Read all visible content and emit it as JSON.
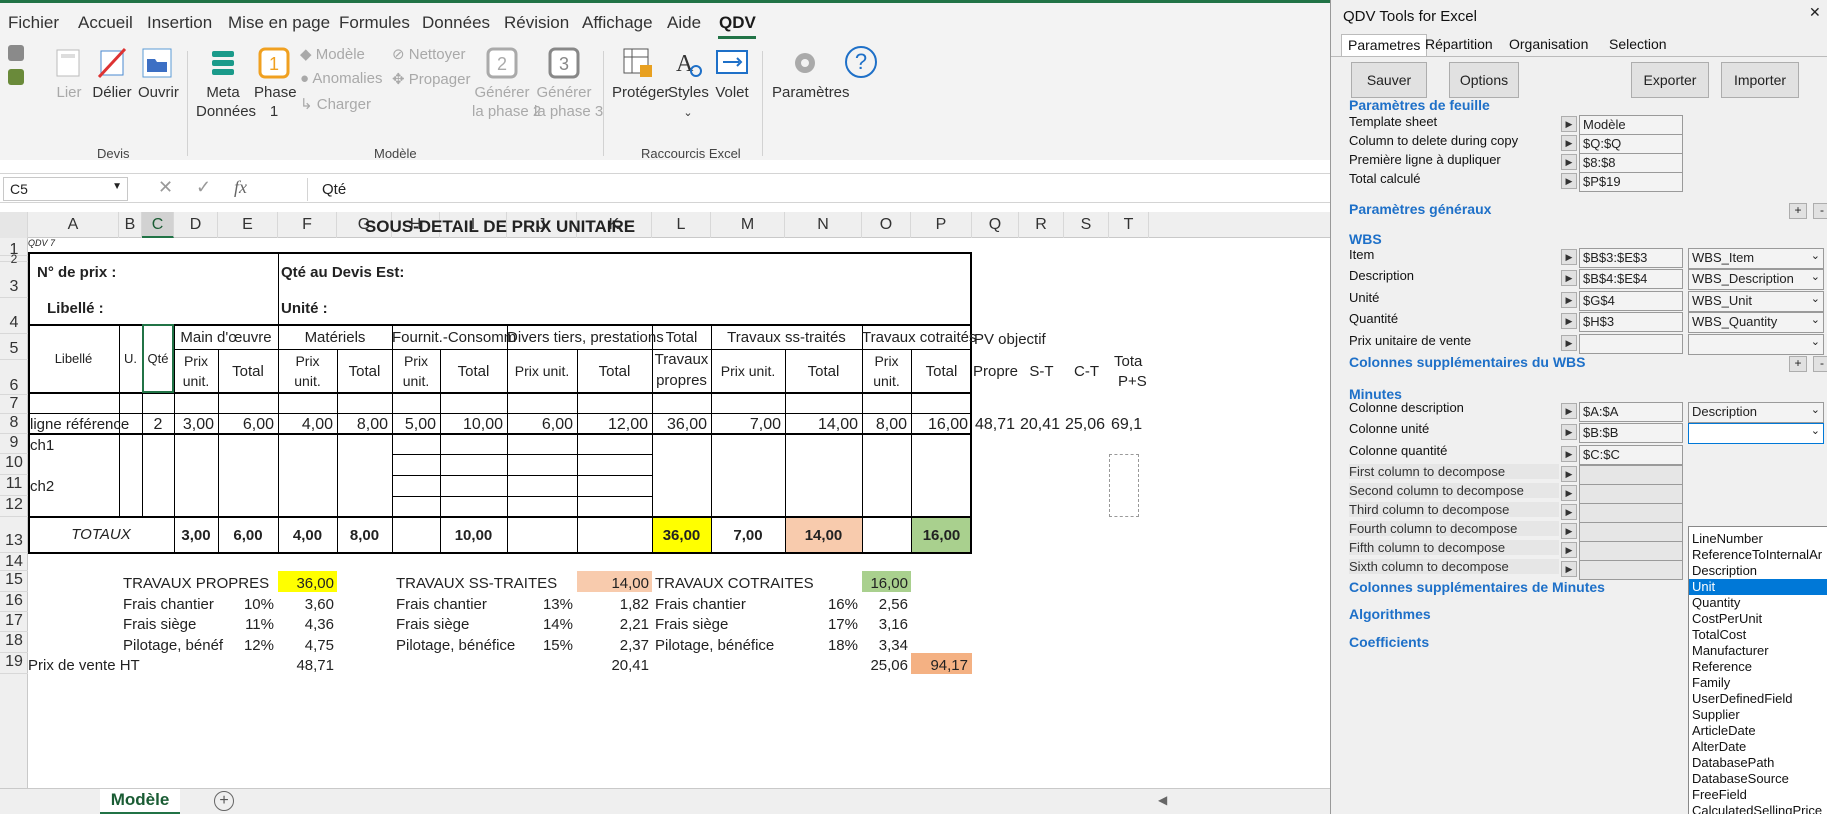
{
  "menu": [
    "Fichier",
    "Accueil",
    "Insertion",
    "Mise en page",
    "Formules",
    "Données",
    "Révision",
    "Affichage",
    "Aide",
    "QDV"
  ],
  "ribbon": {
    "lier": "Lier",
    "delier": "Délier",
    "ouvrir": "Ouvrir",
    "devis_group": "Devis",
    "meta1": "Meta",
    "meta2": "Données",
    "phase1a": "Phase",
    "phase1b": "1",
    "modele": "Modèle",
    "anomalies": "Anomalies",
    "charger": "Charger",
    "nettoyer": "Nettoyer",
    "propager": "Propager",
    "gen2a": "Générer",
    "gen2b": "la phase 2",
    "gen3a": "Générer",
    "gen3b": "la phase 3",
    "modele_group": "Modèle",
    "proteger": "Protéger",
    "styles": "Styles",
    "volet": "Volet",
    "raccourcis_group": "Raccourcis Excel",
    "parametres": "Paramètres"
  },
  "formula_bar": {
    "name_box": "C5",
    "content": "Qté"
  },
  "columns": [
    "A",
    "B",
    "C",
    "D",
    "E",
    "F",
    "G",
    "H",
    "I",
    "J",
    "K",
    "L",
    "M",
    "N",
    "O",
    "P",
    "Q",
    "R",
    "S",
    "T"
  ],
  "rows": [
    "1",
    "2",
    "3",
    "4",
    "5",
    "6",
    "7",
    "8",
    "9",
    "10",
    "11",
    "12",
    "13",
    "14",
    "15",
    "16",
    "17",
    "18",
    "19"
  ],
  "sheet": {
    "title": "SOUS-DETAIL DE PRIX UNITAIRE",
    "qdv": "QDV 7",
    "no_prix": "N° de prix :",
    "qte_devis": "Qté au Devis Est:",
    "libelle": "Libellé :",
    "unite": "Unité :",
    "h_libelle": "Libellé",
    "h_u": "U.",
    "h_qte": "Qté",
    "h_mo": "Main d'œuvre",
    "h_mat": "Matériels",
    "h_fourn": "Fournit.-Consomm",
    "h_divers": "Divers tiers, prestations",
    "h_total": "Total",
    "h_travaux": "Travaux",
    "h_propres": "propres",
    "h_sst": "Travaux ss-traités",
    "h_cot": "Travaux cotraités",
    "h_pv": "PV objectif",
    "prix": "Prix",
    "unit": "unit.",
    "total": "Total",
    "prix_unit": "Prix unit.",
    "propre": "Propre",
    "st": "S-T",
    "ct": "C-T",
    "tota": "Tota",
    "ps": "P+S",
    "r8": {
      "a": "ligne référence",
      "c": "2",
      "d": "3,00",
      "e": "6,00",
      "f": "4,00",
      "g": "8,00",
      "h": "5,00",
      "i": "10,00",
      "j": "6,00",
      "k": "12,00",
      "l": "36,00",
      "m": "7,00",
      "n": "14,00",
      "o": "8,00",
      "p": "16,00",
      "q": "48,71",
      "r": "20,41",
      "s": "25,06",
      "t": "69,1"
    },
    "ch1": "ch1",
    "ch2": "ch2",
    "r13": {
      "a": "TOTAUX",
      "d": "3,00",
      "e": "6,00",
      "f": "4,00",
      "g": "8,00",
      "i": "10,00",
      "l": "36,00",
      "m": "7,00",
      "n": "14,00",
      "p": "16,00"
    },
    "tp": "TRAVAUX PROPRES",
    "tp_v": "36,00",
    "tst": "TRAVAUX SS-TRAITES",
    "tst_v": "14,00",
    "tc": "TRAVAUX COTRAITES",
    "tc_v": "16,00",
    "fc": "Frais chantier",
    "fs": "Frais siège",
    "pb": "Pilotage, bénéf",
    "pb2": "Pilotage, bénéfice",
    "r16": {
      "p1": "10%",
      "v1": "3,60",
      "p2": "13%",
      "v2": "1,82",
      "p3": "16%",
      "v3": "2,56"
    },
    "r17": {
      "p1": "11%",
      "v1": "4,36",
      "p2": "14%",
      "v2": "2,21",
      "p3": "17%",
      "v3": "3,16"
    },
    "r18": {
      "p1": "12%",
      "v1": "4,75",
      "p2": "15%",
      "v2": "2,37",
      "p3": "18%",
      "v3": "3,34"
    },
    "pvht": "Prix de vente HT",
    "r19": {
      "v1": "48,71",
      "v2": "20,41",
      "v3": "25,06",
      "v4": "94,17"
    }
  },
  "sheet_tab": "Modèle",
  "panel": {
    "title": "QDV Tools for Excel",
    "tabs": [
      "Parametres",
      "Répartition",
      "Organisation",
      "Selection"
    ],
    "sauver": "Sauver",
    "options": "Options",
    "exporter": "Exporter",
    "importer": "Importer",
    "sec_feuille": "Paramètres de feuille",
    "template": "Template sheet",
    "template_v": "Modèle",
    "coldel": "Column to delete during copy",
    "coldel_v": "$Q:$Q",
    "premiere": "Première ligne à dupliquer",
    "premiere_v": "$8:$8",
    "totcalc": "Total calculé",
    "totcalc_v": "$P$19",
    "sec_gen": "Paramètres généraux",
    "sec_wbs": "WBS",
    "item": "Item",
    "item_v": "$B$3:$E$3",
    "item_dd": "WBS_Item",
    "desc": "Description",
    "desc_v": "$B$4:$E$4",
    "desc_dd": "WBS_Description",
    "unite": "Unité",
    "unite_v": "$G$4",
    "unite_dd": "WBS_Unit",
    "qte": "Quantité",
    "qte_v": "$H$3",
    "qte_dd": "WBS_Quantity",
    "puv": "Prix unitaire de vente",
    "sec_colsupp": "Colonnes supplémentaires du WBS",
    "sec_min": "Minutes",
    "coldesc": "Colonne description",
    "coldesc_v": "$A:$A",
    "coldesc_dd": "Description",
    "colunit": "Colonne unité",
    "colunit_v": "$B:$B",
    "colqte": "Colonne quantité",
    "colqte_v": "$C:$C",
    "dec1": "First column to decompose",
    "dec2": "Second column to decompose",
    "dec3": "Third column to decompose",
    "dec4": "Fourth column to decompose",
    "dec5": "Fifth column to decompose",
    "dec6": "Sixth column to decompose",
    "sec_colmin": "Colonnes supplémentaires de Minutes",
    "sec_algo": "Algorithmes",
    "sec_coef": "Coefficients",
    "dropdown": [
      "LineNumber",
      "ReferenceToInternalAr",
      "Description",
      "Unit",
      "Quantity",
      "CostPerUnit",
      "TotalCost",
      "Manufacturer",
      "Reference",
      "Family",
      "UserDefinedField",
      "Supplier",
      "ArticleDate",
      "AlterDate",
      "DatabasePath",
      "DatabaseSource",
      "FreeField",
      "CalculatedSellingPrice"
    ],
    "dropdown_selected": "Unit"
  }
}
